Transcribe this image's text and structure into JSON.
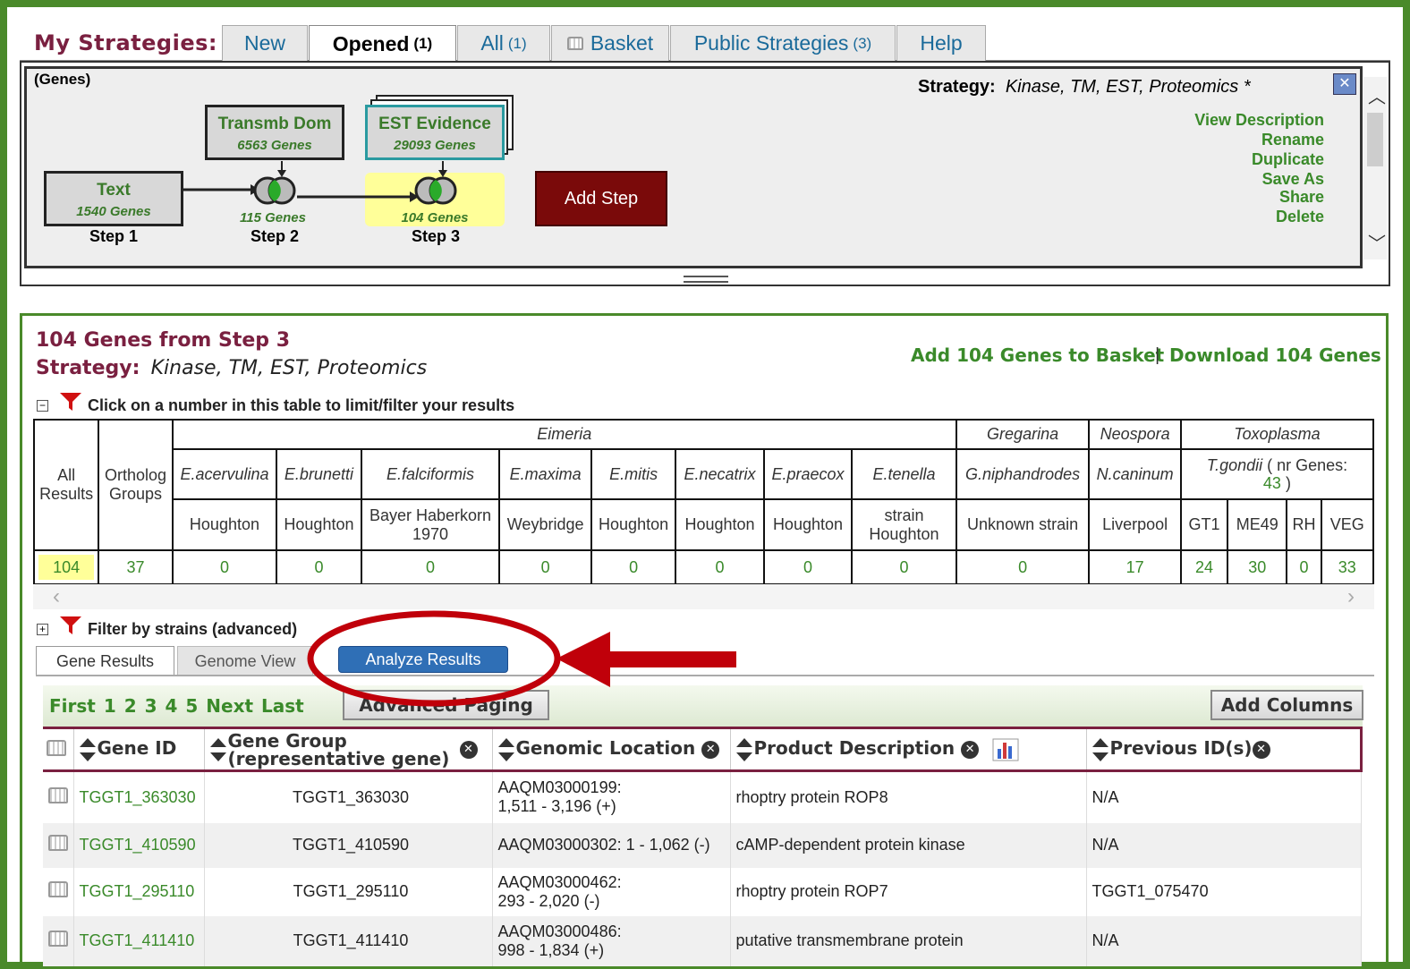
{
  "header": {
    "title": "My Strategies:",
    "tabs": [
      {
        "label": "New",
        "count": ""
      },
      {
        "label": "Opened",
        "count": "(1)"
      },
      {
        "label": "All",
        "count": "(1)"
      },
      {
        "label": "Basket",
        "count": ""
      },
      {
        "label": "Public Strategies",
        "count": "(3)"
      },
      {
        "label": "Help",
        "count": ""
      }
    ]
  },
  "strategy": {
    "record_type": "(Genes)",
    "label": "Strategy:",
    "name": "Kinase, TM, EST, Proteomics *",
    "steps": [
      {
        "name": "Text",
        "count": "1540 Genes",
        "label": "Step 1"
      },
      {
        "name": "Transmb Dom",
        "count": "6563 Genes",
        "combined_count": "115 Genes",
        "label": "Step 2"
      },
      {
        "name": "EST Evidence",
        "count": "29093 Genes",
        "combined_count": "104 Genes",
        "label": "Step 3"
      }
    ],
    "add_step": "Add Step",
    "actions": [
      "View Description",
      "Rename",
      "Duplicate",
      "Save As",
      "Share",
      "Delete"
    ]
  },
  "results": {
    "heading": "104 Genes  from Step 3",
    "strategy_label": "Strategy:",
    "strategy_name": "Kinase, TM, EST, Proteomics",
    "add_basket": "Add 104 Genes to Basket",
    "separator": "|",
    "download": "Download 104 Genes",
    "filter_hint": "Click on a number in this table to limit/filter your results",
    "filter_strains": "Filter by strains (advanced)"
  },
  "filter_table": {
    "all_results": "All Results",
    "ortholog_groups": "Ortholog Groups",
    "genera": [
      "Eimeria",
      "Gregarina",
      "Neospora",
      "Toxoplasma"
    ],
    "species": [
      "E.acervulina",
      "E.brunetti",
      "E.falciformis",
      "E.maxima",
      "E.mitis",
      "E.necatrix",
      "E.praecox",
      "E.tenella",
      "G.niphandrodes",
      "N.caninum"
    ],
    "tgondii": "T.gondii",
    "nr_genes": "( nr Genes:",
    "nr_genes_value": "43",
    "nr_close": ")",
    "strains": [
      "Houghton",
      "Houghton",
      "Bayer Haberkorn 1970",
      "Weybridge",
      "Houghton",
      "Houghton",
      "Houghton",
      "strain Houghton",
      "Unknown strain",
      "Liverpool",
      "GT1",
      "ME49",
      "RH",
      "VEG"
    ],
    "all_value": "104",
    "ortholog_value": "37",
    "values": [
      "0",
      "0",
      "0",
      "0",
      "0",
      "0",
      "0",
      "0",
      "0",
      "17",
      "24",
      "30",
      "0",
      "33"
    ]
  },
  "view_tabs": {
    "gene_results": "Gene Results",
    "genome_view": "Genome View",
    "analyze": "Analyze Results"
  },
  "paging": {
    "first": "First",
    "pages": [
      "1",
      "2",
      "3",
      "4",
      "5"
    ],
    "next": "Next",
    "last": "Last",
    "advanced": "Advanced Paging",
    "add_columns": "Add Columns"
  },
  "columns": {
    "gene_id": "Gene ID",
    "gene_group_1": "Gene Group",
    "gene_group_2": "(representative gene)",
    "genomic_location": "Genomic Location",
    "product_description": "Product Description",
    "previous_ids": "Previous ID(s)"
  },
  "rows": [
    {
      "gene_id": "TGGT1_363030",
      "group": "TGGT1_363030",
      "loc1": "AAQM03000199:",
      "loc2": "1,511 - 3,196 (+)",
      "desc": "rhoptry protein ROP8",
      "prev": "N/A"
    },
    {
      "gene_id": "TGGT1_410590",
      "group": "TGGT1_410590",
      "loc1": "AAQM03000302: 1 - 1,062 (-)",
      "loc2": "",
      "desc": "cAMP-dependent protein kinase",
      "prev": "N/A"
    },
    {
      "gene_id": "TGGT1_295110",
      "group": "TGGT1_295110",
      "loc1": "AAQM03000462:",
      "loc2": "293 - 2,020 (-)",
      "desc": "rhoptry protein ROP7",
      "prev": "TGGT1_075470"
    },
    {
      "gene_id": "TGGT1_411410",
      "group": "TGGT1_411410",
      "loc1": "AAQM03000486:",
      "loc2": "998 - 1,834 (+)",
      "desc": "putative transmembrane protein",
      "prev": "N/A"
    }
  ],
  "colors": {
    "frame": "#4a8a2a",
    "maroon": "#7a2040",
    "link": "#3a8a2a",
    "annotation": "#c0000a",
    "add_step": "#7a0a0a",
    "analyze": "#2f6fb6"
  }
}
